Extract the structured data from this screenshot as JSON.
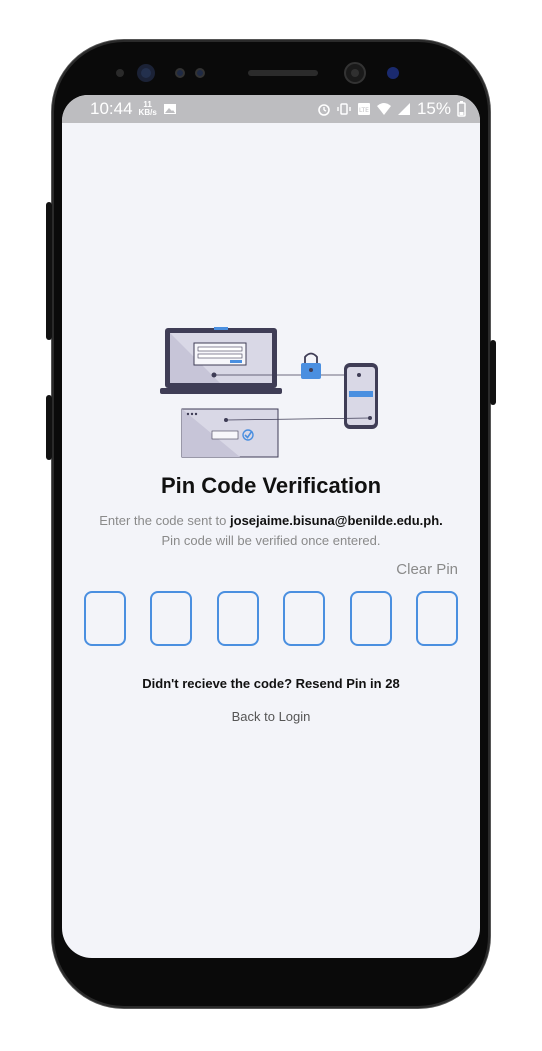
{
  "status_bar": {
    "time": "10:44",
    "net_speed_value": "11",
    "net_speed_unit": "KB/s",
    "battery": "15%"
  },
  "verification": {
    "title": "Pin Code Verification",
    "sent_prefix": "Enter the code sent to ",
    "email": "josejaime.bisuna@benilde.edu.ph.",
    "note": "Pin code will be verified once entered.",
    "clear_pin": "Clear Pin",
    "pin_values": [
      "",
      "",
      "",
      "",
      "",
      ""
    ],
    "resend_text": "Didn't recieve the code? Resend Pin in 28",
    "back_to_login": "Back to Login"
  },
  "colors": {
    "accent": "#4a8fe0",
    "background": "#f3f4f9",
    "status_bar": "#bdbdc0"
  }
}
